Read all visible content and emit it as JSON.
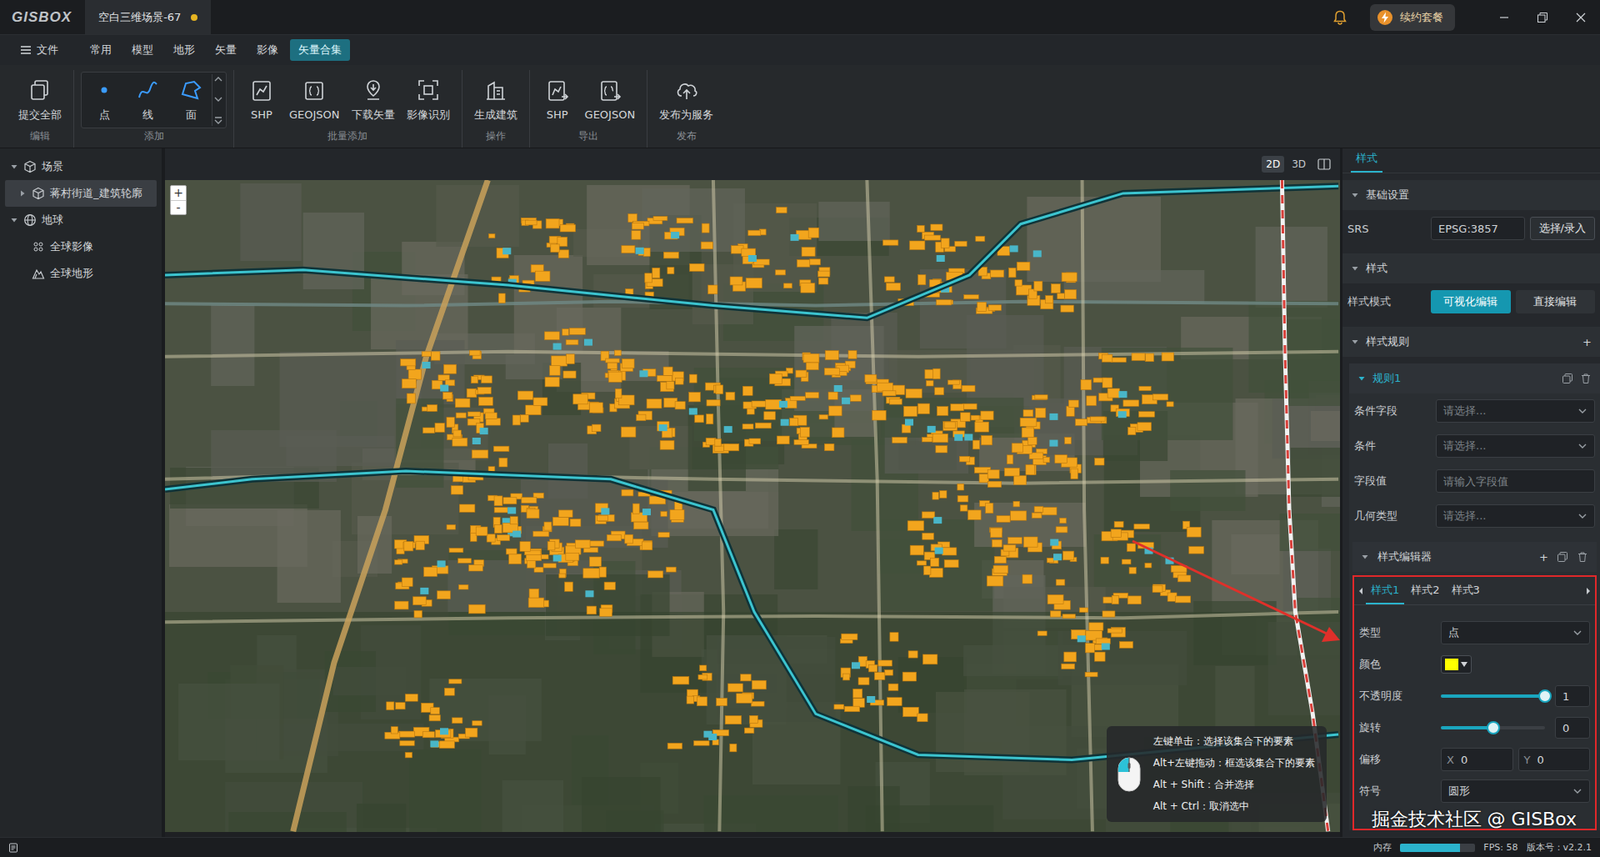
{
  "window": {
    "logo": "GISBOX",
    "tab": {
      "title": "空白三维场景-67",
      "unsaved": true
    },
    "renew_button": "续约套餐"
  },
  "menu": [
    {
      "label": "文件",
      "selected": false
    },
    {
      "label": "常用",
      "selected": false
    },
    {
      "label": "模型",
      "selected": false
    },
    {
      "label": "地形",
      "selected": false
    },
    {
      "label": "矢量",
      "selected": false
    },
    {
      "label": "影像",
      "selected": false
    },
    {
      "label": "矢量合集",
      "selected": true
    }
  ],
  "toolbar": [
    {
      "label": "编辑",
      "kind": "buttons",
      "tools": [
        {
          "label": "提交全部"
        }
      ]
    },
    {
      "label": "添加",
      "kind": "gallery",
      "tools": [
        {
          "label": "点"
        },
        {
          "label": "线"
        },
        {
          "label": "面"
        }
      ]
    },
    {
      "label": "批量添加",
      "kind": "buttons",
      "tools": [
        {
          "label": "SHP"
        },
        {
          "label": "GEOJSON"
        },
        {
          "label": "下载矢量"
        },
        {
          "label": "影像识别"
        }
      ]
    },
    {
      "label": "操作",
      "kind": "buttons",
      "tools": [
        {
          "label": "生成建筑"
        }
      ]
    },
    {
      "label": "导出",
      "kind": "buttons",
      "tools": [
        {
          "label": "SHP"
        },
        {
          "label": "GEOJSON"
        }
      ]
    },
    {
      "label": "发布",
      "kind": "buttons",
      "tools": [
        {
          "label": "发布为服务"
        }
      ]
    }
  ],
  "scene_tree": [
    {
      "label": "场景",
      "depth": 0,
      "expandable": true,
      "expanded": true,
      "selected": false
    },
    {
      "label": "蒋村街道_建筑轮廓",
      "depth": 1,
      "expandable": true,
      "expanded": false,
      "selected": true
    },
    {
      "label": "地球",
      "depth": 0,
      "expandable": true,
      "expanded": true,
      "selected": false
    },
    {
      "label": "全球影像",
      "depth": 1,
      "expandable": false,
      "expanded": false,
      "selected": false
    },
    {
      "label": "全球地形",
      "depth": 1,
      "expandable": false,
      "expanded": false,
      "selected": false
    }
  ],
  "view_modes": [
    {
      "label": "2D",
      "selected": true
    },
    {
      "label": "3D",
      "selected": false
    }
  ],
  "map": {
    "zoom_in": "+",
    "zoom_out": "-",
    "hint": [
      "左键单击：选择该集合下的要素",
      "Alt+左键拖动：框选该集合下的要素",
      "Alt + Shift：合并选择",
      "Alt + Ctrl：取消选中"
    ]
  },
  "watermark": "掘金技术社区 @ GISBox",
  "panel": {
    "tab": {
      "label": "样式",
      "selected": true
    },
    "basic": {
      "title": "基础设置",
      "expanded": true,
      "srs_label": "SRS",
      "srs_value": "EPSG:3857",
      "srs_button": "选择/录入"
    },
    "style": {
      "title": "样式",
      "expanded": true,
      "mode_label": "样式模式",
      "modes": [
        {
          "label": "可视化编辑",
          "selected": true
        },
        {
          "label": "直接编辑",
          "selected": false
        }
      ]
    },
    "rules": {
      "title": "样式规则",
      "expanded": true,
      "add": "+"
    },
    "rule": {
      "title": "规则1",
      "expanded": true,
      "fields": [
        {
          "label": "条件字段",
          "kind": "select",
          "placeholder": "请选择..."
        },
        {
          "label": "条件",
          "kind": "select",
          "placeholder": "请选择..."
        },
        {
          "label": "字段值",
          "kind": "input",
          "placeholder": "请输入字段值"
        },
        {
          "label": "几何类型",
          "kind": "select",
          "placeholder": "请选择..."
        }
      ]
    },
    "editor": {
      "title": "样式编辑器",
      "expanded": true,
      "add": "+",
      "tabs": [
        {
          "label": "样式1",
          "selected": true
        },
        {
          "label": "样式2",
          "selected": false
        },
        {
          "label": "样式3",
          "selected": false
        }
      ],
      "props": [
        {
          "kind": "select",
          "label": "类型",
          "value": "点"
        },
        {
          "kind": "color",
          "label": "颜色",
          "color": "#ffff00"
        },
        {
          "kind": "slider",
          "label": "不透明度",
          "level": 1,
          "reading": "1"
        },
        {
          "kind": "slider",
          "label": "旋转",
          "level": 0.5,
          "reading": "0"
        },
        {
          "kind": "offset",
          "label": "偏移",
          "x_label": "X",
          "x": "0",
          "y_label": "Y",
          "y": "0"
        },
        {
          "kind": "select",
          "label": "符号",
          "value": "圆形"
        }
      ]
    }
  },
  "status_bar": {
    "memory_label": "内存",
    "memory_level": 0.8,
    "fps": "FPS: 58",
    "version": "版本号：v2.2.1"
  }
}
